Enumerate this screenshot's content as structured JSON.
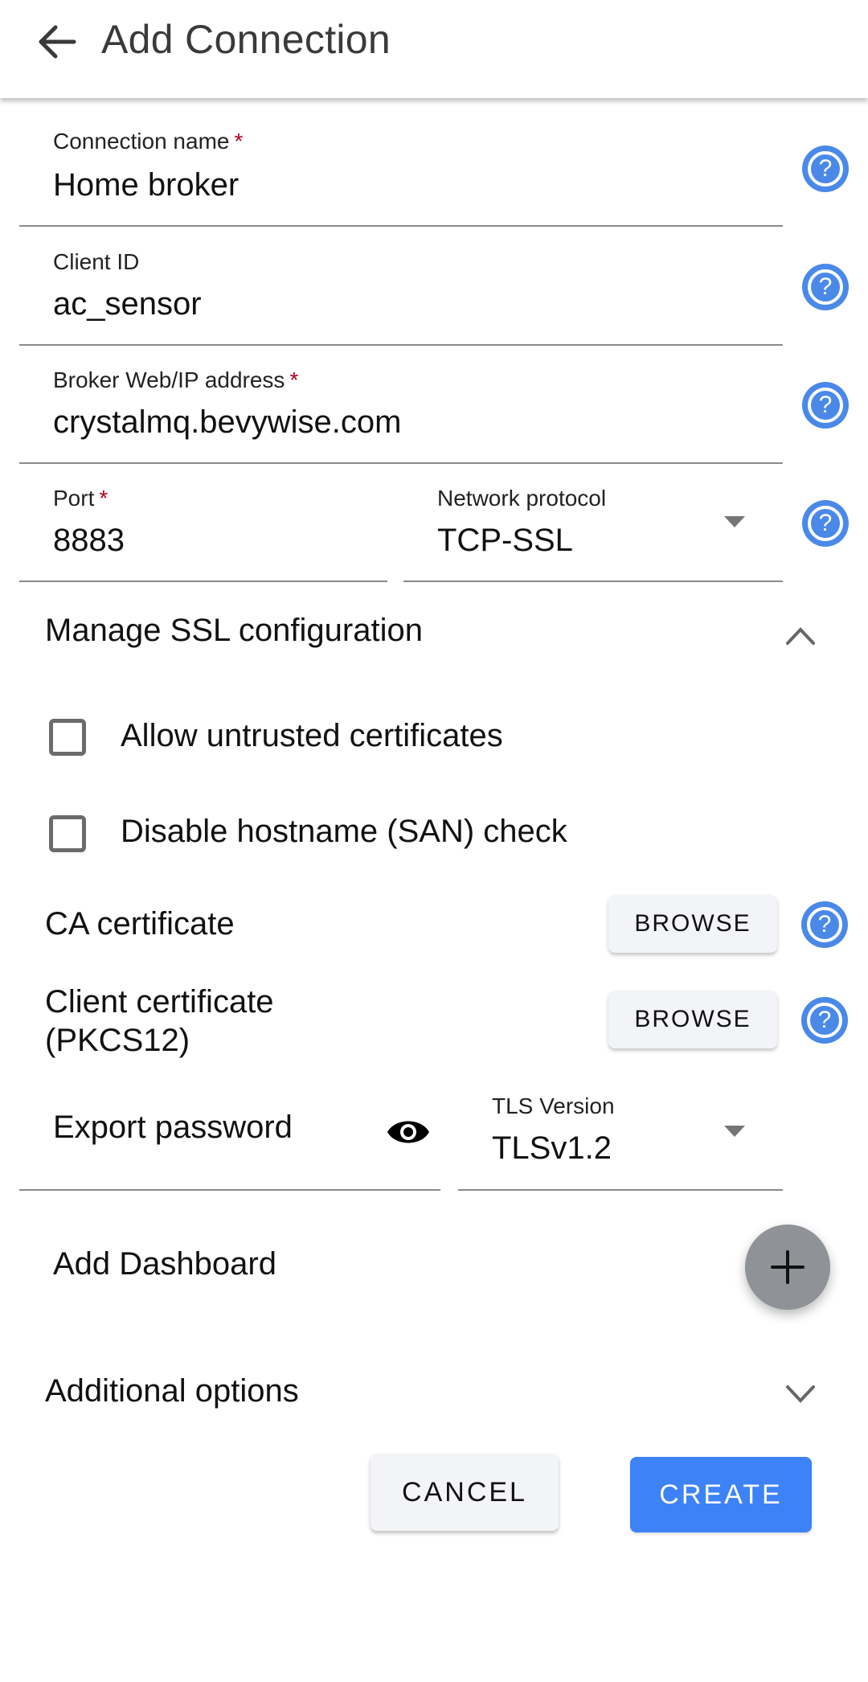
{
  "appbar": {
    "title": "Add Connection",
    "back_icon": "arrow-left-icon"
  },
  "form": {
    "connection_name": {
      "label": "Connection name",
      "required": "*",
      "value": "Home broker"
    },
    "client_id": {
      "label": "Client ID",
      "value": "ac_sensor"
    },
    "broker_address": {
      "label": "Broker Web/IP address",
      "required": "*",
      "value": "crystalmq.bevywise.com"
    },
    "port": {
      "label": "Port",
      "required": "*",
      "value": "8883"
    },
    "network_protocol": {
      "label": "Network protocol",
      "value": "TCP-SSL"
    },
    "help_icon": "?"
  },
  "ssl": {
    "header": "Manage SSL configuration",
    "expanded": true,
    "allow_untrusted": {
      "label": "Allow untrusted certificates",
      "checked": false
    },
    "disable_hostname": {
      "label": "Disable hostname (SAN) check",
      "checked": false
    },
    "ca_certificate": {
      "label": "CA certificate",
      "button": "BROWSE"
    },
    "client_certificate": {
      "label_line1": "Client certificate",
      "label_line2": "(PKCS12)",
      "button": "BROWSE"
    },
    "export_password": {
      "placeholder": "Export password",
      "value": ""
    },
    "tls_version": {
      "label": "TLS Version",
      "value": "TLSv1.2"
    }
  },
  "dashboard": {
    "label": "Add Dashboard",
    "add_icon": "+"
  },
  "additional": {
    "header": "Additional options",
    "expanded": false
  },
  "actions": {
    "cancel": "CANCEL",
    "create": "CREATE"
  },
  "colors": {
    "accent": "#3d82f6",
    "help": "#4a89e8",
    "required": "#b00020",
    "fab": "#8f9297"
  }
}
